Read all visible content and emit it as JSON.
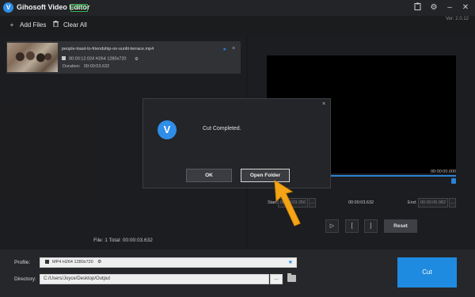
{
  "app": {
    "title": "Gihosoft Video Editor",
    "badge": "FREE",
    "version": "Ver: 2.0.12",
    "logo_letter": "V"
  },
  "titlebar_icons": [
    "clipboard-icon",
    "gear-icon",
    "minimize-icon",
    "close-icon"
  ],
  "toolbar": {
    "add_files_label": "Add Files",
    "clear_all_label": "Clear All"
  },
  "file_list": [
    {
      "filename": "people-toast-to-friendship-on-sunlit-terrace.mp4",
      "specs": "00:00:12.024 H264 1280x720",
      "duration_label": "Duration:",
      "duration_value": "00:00:03.632"
    }
  ],
  "summary_text": "File: 1  Total: 00:00:03.632",
  "player": {
    "current_time": "00:00:00.000",
    "progress": 1.0,
    "start_label": "Start:",
    "start_value": "00:00:03.350",
    "clip_length": "00:00:03.632",
    "end_label": "End:",
    "end_value": "00:00:06.982",
    "play_label": "▷",
    "mark_in_label": "[",
    "mark_out_label": "]",
    "reset_label": "Reset"
  },
  "output": {
    "profile_label": "Profile:",
    "profile_value": "MP4 H264 1280x720",
    "directory_label": "Directory:",
    "directory_value": "C:/Users/Joyce/Desktop/Output",
    "browse_label": "...",
    "cut_label": "Cut"
  },
  "dialog": {
    "message": "Cut Completed.",
    "ok_label": "OK",
    "open_folder_label": "Open Folder",
    "close_label": "×"
  },
  "colors": {
    "accent": "#2f8ee8",
    "cut_button": "#1e8be0",
    "pointer_arrow": "#f4a416"
  }
}
